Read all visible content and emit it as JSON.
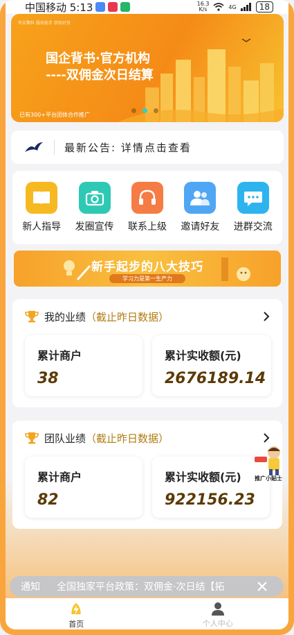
{
  "status_bar": {
    "carrier_time": "中国移动 5:13",
    "net_speed_value": "16.3",
    "net_speed_unit": "K/s",
    "signal": "4G",
    "battery": "18"
  },
  "banner": {
    "tiny_text": "有实聚科  服务能手  获取好资",
    "line1": "国企背书·官方机构",
    "line2": "----双佣金次日结算",
    "caption": "已有300+平台团体合作推广",
    "slide_index": 1,
    "slide_count": 3
  },
  "announcement": {
    "text": "最新公告: 详情点击查看"
  },
  "menu": {
    "items": [
      {
        "label": "新人指导",
        "icon": "book-icon",
        "color": "#f6b921"
      },
      {
        "label": "发圈宣传",
        "icon": "camera-icon",
        "color": "#2ec9b5"
      },
      {
        "label": "联系上级",
        "icon": "headset-icon",
        "color": "#f57c45"
      },
      {
        "label": "邀请好友",
        "icon": "users-icon",
        "color": "#4fa6f5"
      },
      {
        "label": "进群交流",
        "icon": "chat-icon",
        "color": "#2db4ee"
      }
    ]
  },
  "tips": {
    "title": "新手起步的八大技巧",
    "subtitle": "学习力是第一生产力"
  },
  "my_performance": {
    "title": "我的业绩",
    "subtitle": "（截止昨日数据）",
    "merchants_label": "累计商户",
    "merchants_value": "38",
    "amount_label": "累计实收额(元)",
    "amount_value": "2676189.14"
  },
  "team_performance": {
    "title": "团队业绩",
    "subtitle": "（截止昨日数据）",
    "merchants_label": "累计商户",
    "merchants_value": "82",
    "amount_label": "累计实收额(元)",
    "amount_value": "922156.23"
  },
  "promo": {
    "label": "推广小贴士"
  },
  "notice": {
    "label": "通知",
    "message": "全国独家平台政策：双佣金·次日结【拓"
  },
  "tabbar": {
    "home": "首页",
    "profile": "个人中心"
  },
  "colors": {
    "accent": "#f9a53d",
    "value_brown": "#5b3a05",
    "subtitle_gold": "#b07b12"
  }
}
